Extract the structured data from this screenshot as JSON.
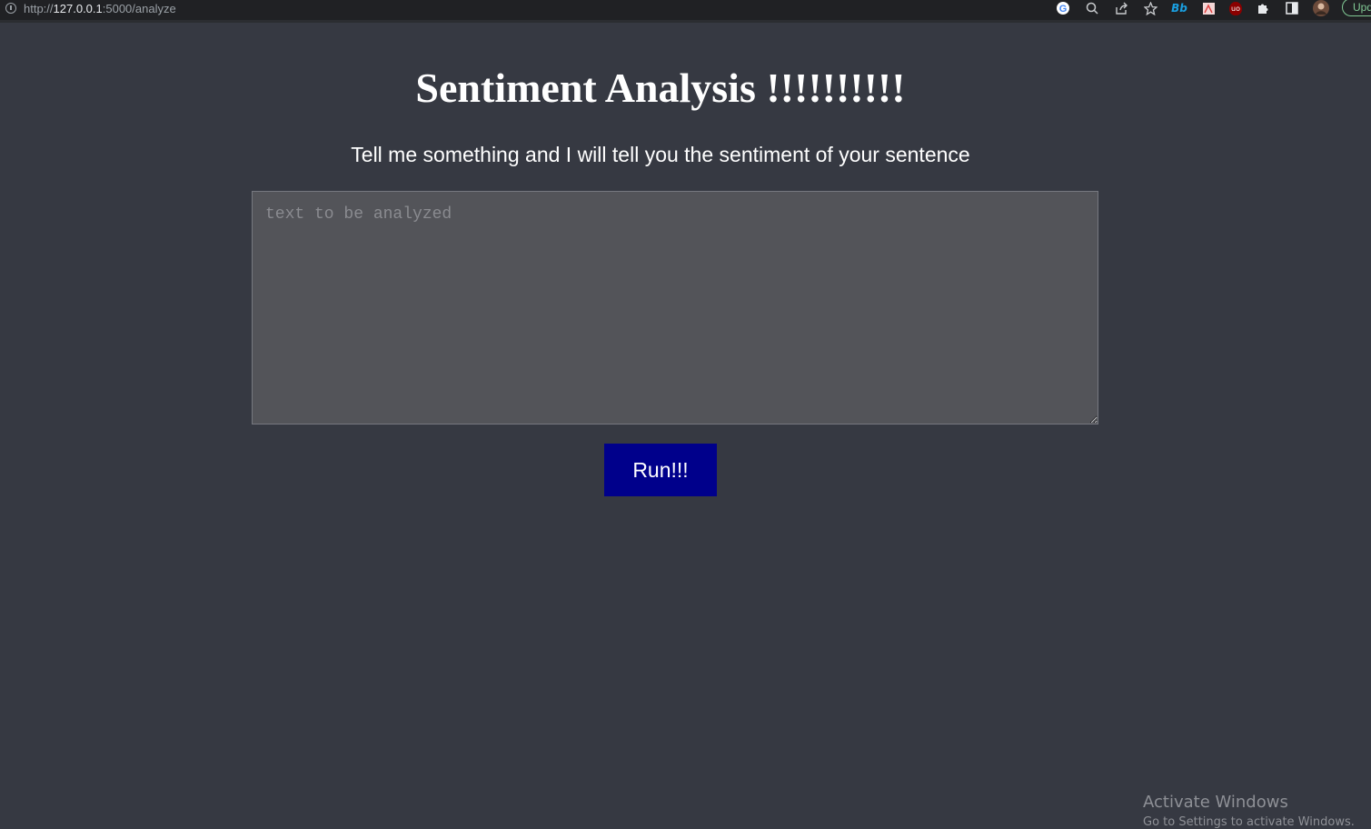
{
  "browser": {
    "url_scheme": "http://",
    "url_host": "127.0.0.1",
    "url_rest": ":5000/analyze",
    "toolbar_icons": [
      "google-icon",
      "zoom-icon",
      "share-icon",
      "star-icon",
      "bb-extension-icon",
      "pdf-extension-icon",
      "ublock-icon",
      "puzzle-icon",
      "sidepanel-icon",
      "profile-avatar"
    ],
    "bb_label": "Bb",
    "ublock_label": "uo",
    "update_label": "Upd"
  },
  "page": {
    "title": "Sentiment Analysis !!!!!!!!!!",
    "subtitle": "Tell me something and I will tell you the sentiment of your sentence",
    "input_placeholder": "text to be analyzed",
    "input_value": "",
    "run_label": "Run!!!"
  },
  "os": {
    "watermark_title": "Activate Windows",
    "watermark_sub": "Go to Settings to activate Windows."
  },
  "colors": {
    "background": "#363942",
    "button": "#00008b",
    "textarea": "#535459"
  }
}
